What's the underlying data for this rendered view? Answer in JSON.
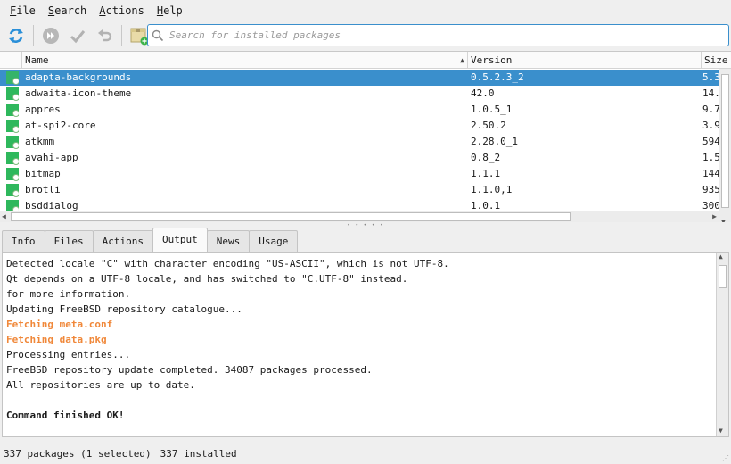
{
  "menu": {
    "items": [
      {
        "label": "File",
        "acc": "F",
        "rest": "ile"
      },
      {
        "label": "Search",
        "acc": "S",
        "rest": "earch"
      },
      {
        "label": "Actions",
        "acc": "A",
        "rest": "ctions"
      },
      {
        "label": "Help",
        "acc": "H",
        "rest": "elp"
      }
    ]
  },
  "toolbar": {
    "buttons": [
      {
        "icon": "sync-icon"
      },
      {
        "icon": "fast-forward-icon"
      },
      {
        "icon": "checkmark-icon"
      },
      {
        "icon": "undo-icon"
      },
      {
        "icon": "package-add-icon"
      }
    ],
    "search_placeholder": "Search for installed packages",
    "search_value": ""
  },
  "table": {
    "columns": {
      "name": "Name",
      "version": "Version",
      "size": "Size"
    },
    "sort_column": "Name",
    "rows": [
      {
        "name": "adapta-backgrounds",
        "version": "0.5.2.3_2",
        "size": "5.3",
        "selected": true
      },
      {
        "name": "adwaita-icon-theme",
        "version": "42.0",
        "size": "14.",
        "selected": false
      },
      {
        "name": "appres",
        "version": "1.0.5_1",
        "size": "9.7",
        "selected": false
      },
      {
        "name": "at-spi2-core",
        "version": "2.50.2",
        "size": "3.9",
        "selected": false
      },
      {
        "name": "atkmm",
        "version": "2.28.0_1",
        "size": "594",
        "selected": false
      },
      {
        "name": "avahi-app",
        "version": "0.8_2",
        "size": "1.5",
        "selected": false
      },
      {
        "name": "bitmap",
        "version": "1.1.1",
        "size": "144",
        "selected": false
      },
      {
        "name": "brotli",
        "version": "1.1.0,1",
        "size": "935",
        "selected": false
      },
      {
        "name": "bsddialog",
        "version": "1.0.1",
        "size": "300",
        "selected": false
      }
    ]
  },
  "tabs": {
    "items": [
      "Info",
      "Files",
      "Actions",
      "Output",
      "News",
      "Usage"
    ],
    "active": "Output"
  },
  "output": {
    "lines": [
      {
        "text": "Detected locale \"C\" with character encoding \"US-ASCII\", which is not UTF-8.",
        "style": "normal"
      },
      {
        "text": "Qt depends on a UTF-8 locale, and has switched to \"C.UTF-8\" instead.",
        "style": "normal"
      },
      {
        "text": "for more information.",
        "style": "normal"
      },
      {
        "text": "Updating FreeBSD repository catalogue...",
        "style": "normal"
      },
      {
        "text": "Fetching meta.conf",
        "style": "warn"
      },
      {
        "text": "Fetching data.pkg",
        "style": "warn"
      },
      {
        "text": "Processing entries...",
        "style": "normal"
      },
      {
        "text": "FreeBSD repository update completed. 34087 packages processed.",
        "style": "normal"
      },
      {
        "text": "All repositories are up to date.",
        "style": "normal"
      },
      {
        "text": "",
        "style": "normal"
      },
      {
        "text": "Command finished OK!",
        "style": "bold"
      }
    ]
  },
  "status": {
    "packages": "337 packages (1 selected)",
    "installed": "337 installed"
  },
  "colors": {
    "selection": "#3a8fcc",
    "fetch_text": "#f0883a",
    "package_icon": "#2eb85c"
  }
}
